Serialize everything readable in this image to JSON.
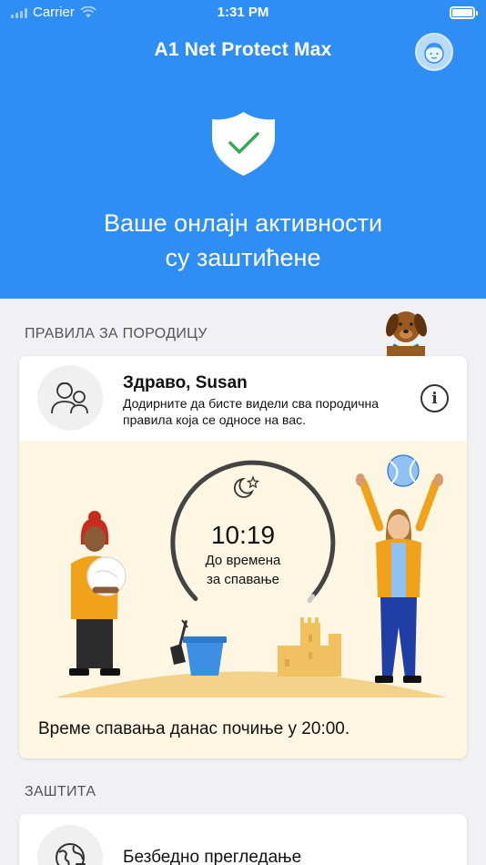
{
  "status_bar": {
    "carrier": "Carrier",
    "time": "1:31 PM"
  },
  "header": {
    "app_title": "A1 Net Protect Max",
    "status_line1": "Ваше онлајн активности",
    "status_line2": "су заштићене"
  },
  "family_section": {
    "label": "ПРАВИЛА ЗА ПОРОДИЦУ",
    "greeting_title": "Здраво, Susan",
    "greeting_subtitle": "Додирните да бисте видели сва породична правила која се односе на вас.",
    "timer_time": "10:19",
    "timer_label_line1": "До времена",
    "timer_label_line2": "за спавање",
    "timer_progress": 0.84,
    "bedtime_note": "Време спавања данас почиње у 20:00."
  },
  "protection_section": {
    "label": "ЗАШТИТА",
    "item_title": "Безбедно прегледање"
  },
  "colors": {
    "header_blue": "#2f8ef4",
    "check_green": "#3aa755",
    "card_cream": "#fdf6e3"
  },
  "icons": [
    "signal-icon",
    "wifi-icon",
    "battery-icon",
    "avatar-icon",
    "shield-check-icon",
    "family-icon",
    "info-icon",
    "moon-star-icon",
    "globe-icon"
  ]
}
